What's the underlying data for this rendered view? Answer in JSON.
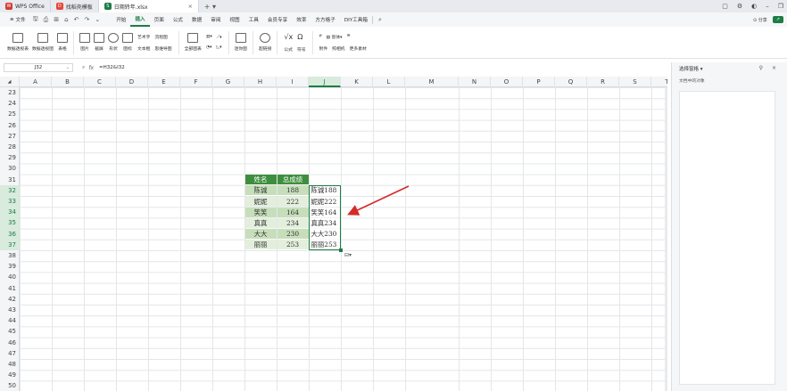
{
  "tabs": [
    {
      "label": "WPS Office",
      "icon": "wps-logo-icon",
      "color": "#d23b35"
    },
    {
      "label": "找稻壳模板",
      "icon": "docer-icon",
      "color": "#e8443a"
    },
    {
      "label": "日期转年.xlsx",
      "icon": "sheet-icon",
      "color": "#1e7c45",
      "active": true
    }
  ],
  "menu": {
    "file": "文件",
    "items": [
      "开始",
      "插入",
      "页面",
      "公式",
      "数据",
      "审阅",
      "视图",
      "工具",
      "会员专享",
      "效率",
      "方方格子",
      "DIY工具箱"
    ],
    "active": "插入",
    "share": "分享"
  },
  "ribbon": {
    "big1": [
      "数据透视表",
      "数据透视图",
      "表格"
    ],
    "pic": [
      "图片",
      "截屏",
      "形状",
      "图标"
    ],
    "group1": {
      "row1": [
        "艺术字",
        "流程图"
      ],
      "row2": [
        "文本框",
        "思维导图"
      ]
    },
    "charts": [
      "全部图表"
    ],
    "group2": {
      "row1": [
        "▾",
        "▾"
      ],
      "row2": [
        "▾",
        "▾"
      ]
    },
    "minis": [
      "迷你图",
      "超链接"
    ],
    "group3": {
      "row1": [
        "公式",
        "符号"
      ]
    },
    "group4": {
      "row1": [
        "附件",
        "照相机",
        "更多素材"
      ],
      "row2": [
        "窗体"
      ]
    }
  },
  "formula_bar": {
    "name_box": "J32",
    "formula": "=H32&I32"
  },
  "columns": [
    "A",
    "B",
    "C",
    "D",
    "E",
    "F",
    "G",
    "H",
    "I",
    "J",
    "K",
    "L",
    "M",
    "N",
    "O",
    "P",
    "Q",
    "R",
    "S",
    "T"
  ],
  "selected_column": "J",
  "rows": [
    "23",
    "24",
    "25",
    "26",
    "27",
    "28",
    "29",
    "30",
    "31",
    "32",
    "33",
    "34",
    "35",
    "36",
    "37",
    "38",
    "39",
    "40",
    "41",
    "42",
    "43",
    "44",
    "45",
    "46",
    "47",
    "48",
    "49",
    "50"
  ],
  "selected_rows": [
    "32",
    "33",
    "34",
    "35",
    "36",
    "37"
  ],
  "table": {
    "headers": [
      "姓名",
      "总成绩"
    ],
    "rows": [
      {
        "name": "陈诚",
        "score": "188",
        "result": "陈诚188"
      },
      {
        "name": "妮妮",
        "score": "222",
        "result": "妮妮222"
      },
      {
        "name": "笑笑",
        "score": "164",
        "result": "笑笑164"
      },
      {
        "name": "真真",
        "score": "234",
        "result": "真真234"
      },
      {
        "name": "大大",
        "score": "230",
        "result": "大大230"
      },
      {
        "name": "丽丽",
        "score": "253",
        "result": "丽丽253"
      }
    ]
  },
  "side_pane": {
    "title": "选择窗格 ▾",
    "subtitle": "文档中的对象"
  },
  "colors": {
    "accent": "#1e7c45",
    "header": "#3e8e3f",
    "band_odd": "#c6dfba",
    "band_even": "#e3efdc",
    "arrow": "#d42a2a"
  }
}
